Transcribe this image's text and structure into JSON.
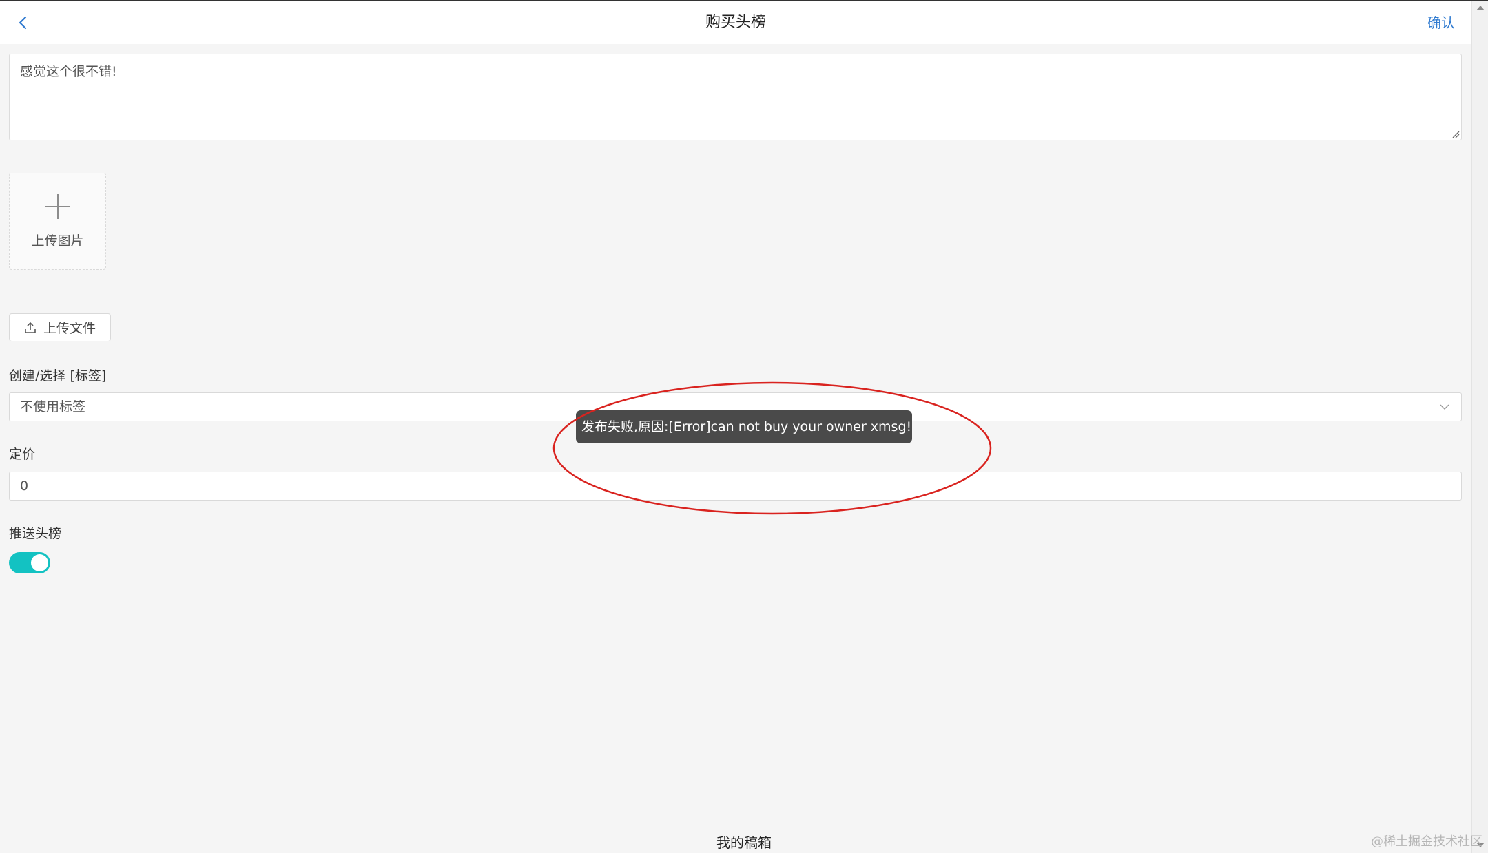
{
  "header": {
    "title": "购买头榜",
    "confirm_label": "确认"
  },
  "comment": {
    "value": "感觉这个很不错!"
  },
  "upload_image": {
    "label": "上传图片"
  },
  "upload_file": {
    "label": "上传文件"
  },
  "tag": {
    "label": "创建/选择 [标签]",
    "selected": "不使用标签"
  },
  "price": {
    "label": "定价",
    "value": "0"
  },
  "push_top": {
    "label": "推送头榜",
    "enabled": true
  },
  "toast": {
    "message": "发布失败,原因:[Error]can not buy your owner xmsg!"
  },
  "footer": {
    "link": "我的稿箱"
  },
  "watermark": "@稀土掘金技术社区",
  "colors": {
    "accent_link": "#2f7ad0",
    "toggle_on": "#13c2c2",
    "annotation": "#d9231f",
    "toast_bg": "#4a4a4a"
  }
}
